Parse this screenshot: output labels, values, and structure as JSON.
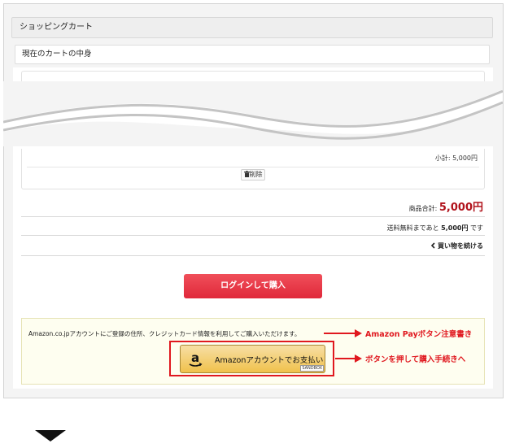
{
  "cart": {
    "title": "ショッピングカート",
    "contents_label": "現在のカートの中身",
    "subtotal": "小計: 5,000円",
    "delete_label": "削除"
  },
  "summary": {
    "total_label": "商品合計: ",
    "total_value": "5,000円",
    "shipping_prefix": "送料無料まであと ",
    "shipping_amount": "5,000円",
    "shipping_suffix": " です",
    "continue_label": "買い物を続ける"
  },
  "login_button": "ログインして購入",
  "amazon": {
    "note": "Amazon.co.jpアカウントにご登録の住所、クレジットカード情報を利用してご購入いただけます。",
    "button_label": "Amazonアカウントでお支払い",
    "sandbox": "SANDBOX",
    "logo_letter": "a"
  },
  "annotations": {
    "note_callout": "Amazon Payボタン注意書き",
    "button_callout": "ボタンを押して購入手続きへ"
  },
  "colors": {
    "accent_red": "#e0181f",
    "price_red": "#b0121b",
    "login_button": "#e8323f",
    "amazon_button": "#f0c14b"
  },
  "icons": {
    "trash": "trash-icon",
    "chevron": "chevron-left-icon",
    "down_arrow": "triangle-down-icon"
  }
}
